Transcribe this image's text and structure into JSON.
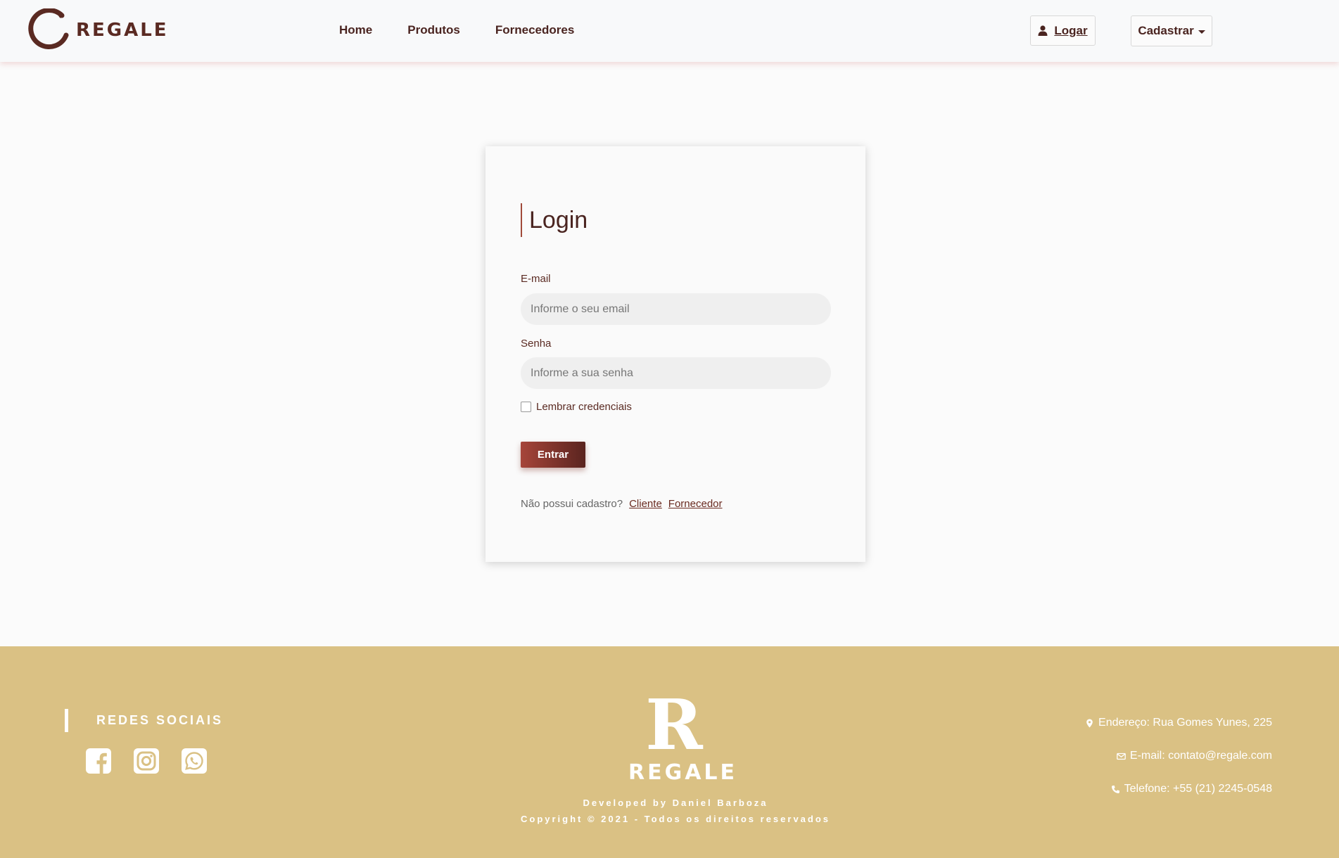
{
  "header": {
    "brand": "REGALE",
    "nav": [
      "Home",
      "Produtos",
      "Fornecedores"
    ],
    "login_label": "Logar",
    "signup_label": "Cadastrar"
  },
  "login": {
    "title": "Login",
    "email_label": "E-mail",
    "email_placeholder": "Informe o seu email",
    "password_label": "Senha",
    "password_placeholder": "Informe a sua senha",
    "remember_label": "Lembrar credenciais",
    "submit_label": "Entrar",
    "no_account": "Não possui cadastro?",
    "client_link": "Cliente",
    "supplier_link": "Fornecedor"
  },
  "footer": {
    "social_title": "REDES SOCIAIS",
    "social_icons": [
      "facebook-icon",
      "instagram-icon",
      "whatsapp-icon"
    ],
    "logo_letter": "R",
    "logo_word": "REGALE",
    "developer": "Developed by Daniel Barboza",
    "copyright": "Copyright © 2021 - Todos os direitos reservados",
    "address": "Endereço: Rua Gomes Yunes, 225",
    "email": "E-mail: contato@regale.com",
    "phone": "Telefone: +55 (21) 2245-0548"
  },
  "colors": {
    "brand": "#5a2a22",
    "accent_button_start": "#a6453a",
    "accent_button_end": "#5a241f",
    "footer_bg": "#dac184",
    "page_bg": "#fbfbfb"
  }
}
